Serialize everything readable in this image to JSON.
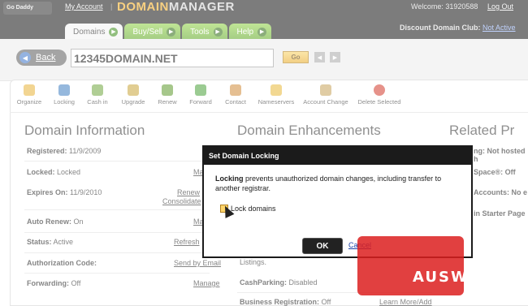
{
  "header": {
    "logo_text": "Go Daddy",
    "my_account": "My Account",
    "separator": "|",
    "brand_part1": "DOMAIN",
    "brand_part2": "MANAGER",
    "welcome": "Welcome: 31920588",
    "logout": "Log Out",
    "discount_label": "Discount Domain Club:",
    "discount_value": "Not Active"
  },
  "tabs": [
    {
      "label": "Domains",
      "active": true
    },
    {
      "label": "Buy/Sell",
      "active": false
    },
    {
      "label": "Tools",
      "active": false
    },
    {
      "label": "Help",
      "active": false
    }
  ],
  "search": {
    "back_label": "Back",
    "domain_value": "12345DOMAIN.NET",
    "go_label": "Go"
  },
  "toolbar": [
    {
      "label": "Organize",
      "icon": "folder-icon",
      "color": "#e8b23a"
    },
    {
      "label": "Locking",
      "icon": "lock-icon",
      "color": "#3e7fc1"
    },
    {
      "label": "Cash in",
      "icon": "cash-icon",
      "color": "#6fa63f"
    },
    {
      "label": "Upgrade",
      "icon": "award-icon",
      "color": "#c9a43a"
    },
    {
      "label": "Renew",
      "icon": "renew-icon",
      "color": "#5d9a2c"
    },
    {
      "label": "Forward",
      "icon": "forward-arrow-icon",
      "color": "#4aa03a"
    },
    {
      "label": "Contact",
      "icon": "contact-icon",
      "color": "#d08a3a"
    },
    {
      "label": "Nameservers",
      "icon": "database-icon",
      "color": "#e7b83a"
    },
    {
      "label": "Account Change",
      "icon": "edit-icon",
      "color": "#c6a25a"
    },
    {
      "label": "Delete Selected",
      "icon": "delete-icon",
      "color": "#d23a2a"
    }
  ],
  "domain_info": {
    "heading": "Domain Information",
    "registered": {
      "label": "Registered:",
      "value": "11/9/2009"
    },
    "locked": {
      "label": "Locked:",
      "value": "Locked",
      "link": "Ma"
    },
    "expires": {
      "label": "Expires On:",
      "value": "11/9/2010",
      "link1": "Renew",
      "link2": "Consolidate"
    },
    "auto_renew": {
      "label": "Auto Renew:",
      "value": "On",
      "link": "Ma"
    },
    "status": {
      "label": "Status:",
      "value": "Active",
      "link": "Refresh"
    },
    "auth_code": {
      "label": "Authorization Code:",
      "link": "Send by Email"
    },
    "forwarding": {
      "label": "Forwarding:",
      "value": "Off",
      "link": "Manage"
    }
  },
  "enhancements": {
    "heading": "Domain Enhancements",
    "listings_text": "Listings.",
    "cashparking": {
      "label": "CashParking:",
      "value": "Disabled"
    },
    "business_reg": {
      "label": "Business Registration:",
      "value": "Off",
      "link": "Learn More/Add"
    }
  },
  "related": {
    "heading": "Related Pr",
    "row1": "ng: Not hosted h",
    "row2": "Space®: Off",
    "row3": "Accounts: No e",
    "row4": "in Starter Page"
  },
  "dialog": {
    "title": "Set Domain Locking",
    "msg_bold": "Locking",
    "msg_rest": " prevents unauthorized domain changes, including transfer to another registrar.",
    "checkbox_label": "Lock domains",
    "ok_label": "OK",
    "cancel_label": "Cancel"
  },
  "watermark": {
    "text": "AUSWEB"
  }
}
